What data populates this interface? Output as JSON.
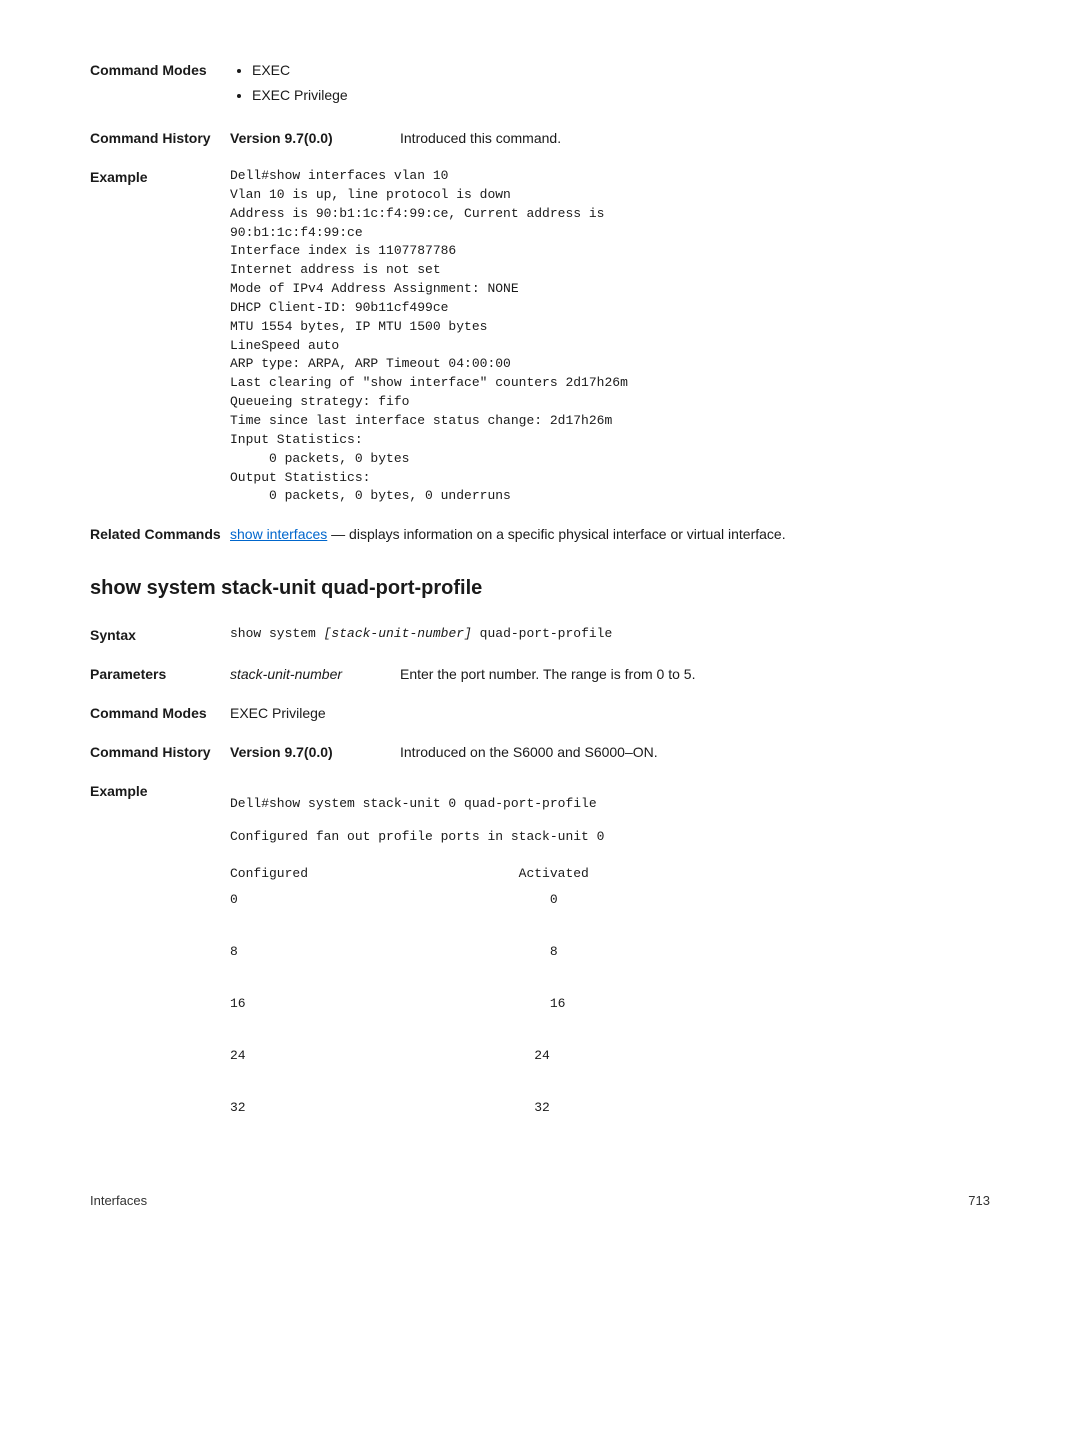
{
  "block1": {
    "modes_label": "Command Modes",
    "modes_items": [
      "EXEC",
      "EXEC Privilege"
    ],
    "history_label": "Command History",
    "version_label": "Version 9.7(0.0)",
    "version_desc": "Introduced this command.",
    "example_label": "Example",
    "example_code": "Dell#show interfaces vlan 10\nVlan 10 is up, line protocol is down\nAddress is 90:b1:1c:f4:99:ce, Current address is\n90:b1:1c:f4:99:ce\nInterface index is 1107787786\nInternet address is not set\nMode of IPv4 Address Assignment: NONE\nDHCP Client-ID: 90b11cf499ce\nMTU 1554 bytes, IP MTU 1500 bytes\nLineSpeed auto\nARP type: ARPA, ARP Timeout 04:00:00\nLast clearing of \"show interface\" counters 2d17h26m\nQueueing strategy: fifo\nTime since last interface status change: 2d17h26m\nInput Statistics:\n     0 packets, 0 bytes\nOutput Statistics:\n     0 packets, 0 bytes, 0 underruns",
    "related_label": "Related Commands",
    "related_link": "show interfaces",
    "related_rest": " — displays information on a specific physical interface or virtual interface."
  },
  "section_heading": "show system stack-unit quad-port-profile",
  "block2": {
    "syntax_label": "Syntax",
    "syntax_code_prefix": "show system ",
    "syntax_code_italic": "[stack-unit-number]",
    "syntax_code_suffix": " quad-port-profile",
    "params_label": "Parameters",
    "param_name": "stack-unit-number",
    "param_desc": "Enter the port number. The range is from 0 to 5.",
    "modes_label": "Command Modes",
    "modes_text": "EXEC Privilege",
    "history_label": "Command History",
    "version_label": "Version 9.7(0.0)",
    "version_desc": "Introduced on the S6000 and S6000–ON.",
    "example_label": "Example",
    "example_line1": "Dell#show system stack-unit 0 quad-port-profile",
    "example_line2": "Configured fan out profile ports in stack-unit 0",
    "table": "Configured                           Activated\n0                                        0\n\n8                                        8\n\n16                                       16\n\n24                                     24\n\n32                                     32"
  },
  "footer_left": "Interfaces",
  "footer_right": "713"
}
